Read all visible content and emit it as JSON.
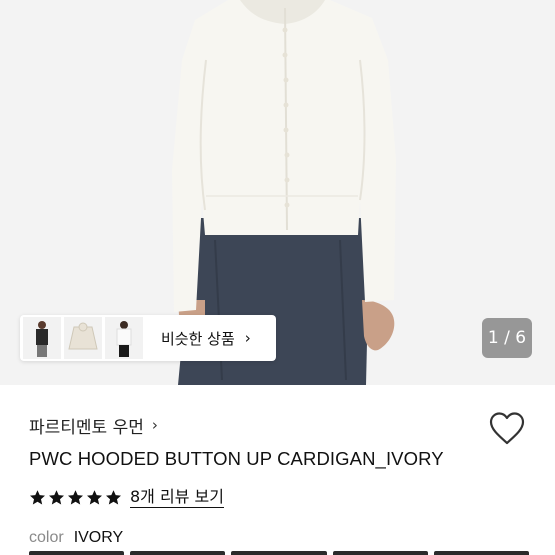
{
  "gallery": {
    "counter": "1 / 6",
    "similar": {
      "label": "비슷한 상품",
      "thumbnails": [
        "black-cardigan-thumb",
        "ivory-cardigan-thumb",
        "white-top-thumb"
      ]
    }
  },
  "product": {
    "brand": "파르티멘토 우먼",
    "title": "PWC HOODED BUTTON UP CARDIGAN_IVORY",
    "rating": 5,
    "review_link": "8개 리뷰 보기",
    "color_label": "color",
    "color_value": "IVORY"
  },
  "icons": {
    "chevron": "›",
    "wishlist": "heart-outline-icon",
    "star": "star-filled-icon"
  },
  "colors": {
    "photo_bg": "#f3f3f3",
    "cardigan": "#f7f6f1",
    "skirt": "#3d4656",
    "counter_bg": "#7a7a7a"
  }
}
